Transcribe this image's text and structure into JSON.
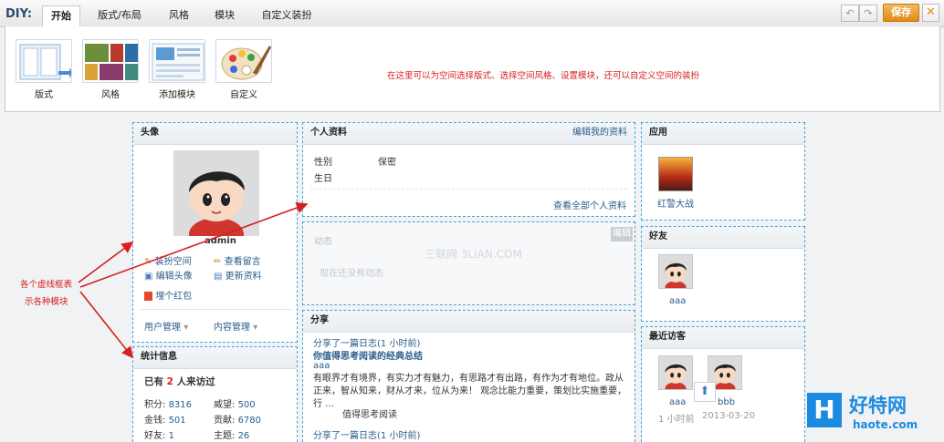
{
  "toolbar": {
    "diy_label": "DIY:",
    "tabs": [
      "开始",
      "版式/布局",
      "风格",
      "模块",
      "自定义装扮"
    ],
    "undo_icon": "undo-icon",
    "redo_icon": "redo-icon",
    "save_label": "保存",
    "close_label": "✕"
  },
  "panel": {
    "tools": [
      {
        "label": "版式",
        "icon": "layout-icon"
      },
      {
        "label": "风格",
        "icon": "style-icon"
      },
      {
        "label": "添加模块",
        "icon": "add-module-icon"
      },
      {
        "label": "自定义",
        "icon": "palette-icon"
      }
    ],
    "hint": "在这里可以为空间选择版式、选择空间风格、设置模块，还可以自定义空间的装扮"
  },
  "avatar_module": {
    "title": "头像",
    "username": "admin",
    "actions": [
      "装扮空间",
      "查看留言",
      "编辑头像",
      "更新资料",
      "埋个红包"
    ],
    "menus": [
      "用户管理",
      "内容管理"
    ]
  },
  "stats_module": {
    "title": "统计信息",
    "visits_prefix": "已有",
    "visits_count": "2",
    "visits_suffix": "人来访过",
    "rows": [
      {
        "label": "积分:",
        "value": "8316",
        "label2": "威望:",
        "value2": "500"
      },
      {
        "label": "金钱:",
        "value": "501",
        "label2": "贡献:",
        "value2": "6780"
      },
      {
        "label": "好友:",
        "value": "1",
        "label2": "主题:",
        "value2": "26"
      }
    ]
  },
  "profile_module": {
    "title": "个人资料",
    "edit_link": "编辑我的资料",
    "fields": [
      {
        "label": "性别",
        "value": "保密"
      },
      {
        "label": "生日",
        "value": ""
      }
    ],
    "view_all": "查看全部个人资料"
  },
  "feed_module": {
    "title": "动态",
    "edit_label": "编辑",
    "empty": "现在还没有动态",
    "watermark": "三联网 3LIAN.COM"
  },
  "share_module": {
    "title": "分享",
    "items": [
      {
        "meta": "分享了一篇日志(1 小时前)",
        "title": "你值得思考阅读的经典总结",
        "author": "aaa",
        "body": "有眼界才有境界，有实力才有魅力，有思路才有出路，有作为才有地位。政从正来，智从知来，财从才来，位从为来！  观念比能力重要，策划比实施重要，行 …",
        "quote": "值得思考阅读"
      },
      {
        "meta": "分享了一篇日志(1 小时前)",
        "title": "",
        "author": "",
        "body": "",
        "quote": ""
      }
    ]
  },
  "apps_module": {
    "title": "应用",
    "apps": [
      {
        "name": "红警大战"
      }
    ]
  },
  "friends_module": {
    "title": "好友",
    "friends": [
      {
        "name": "aaa"
      }
    ]
  },
  "visitors_module": {
    "title": "最近访客",
    "visitors": [
      {
        "name": "aaa",
        "time": "1 小时前"
      },
      {
        "name": "bbb",
        "time": "2013-03-20"
      }
    ]
  },
  "annotation": {
    "line1": "各个虚线框表",
    "line2": "示各种模块"
  },
  "watermark": {
    "logo_letter": "H",
    "site": "好特网",
    "url": "haote.com"
  }
}
